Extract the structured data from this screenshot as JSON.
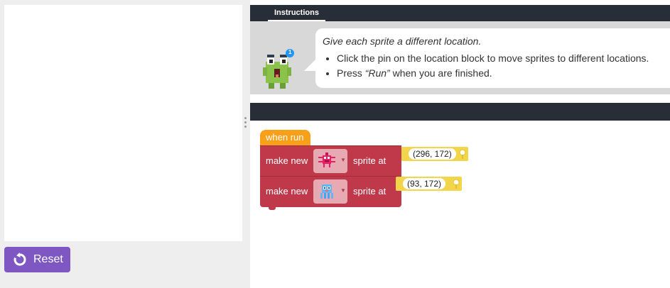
{
  "stage": {
    "reset_label": "Reset"
  },
  "instructions": {
    "tab_label": "Instructions",
    "title": "Give each sprite a different location.",
    "bullet1": "Click the pin on the location block to move sprites to different locations.",
    "bullet2_pre": "Press ",
    "bullet2_run": "“Run”",
    "bullet2_post": " when you are finished.",
    "badge_count": "1"
  },
  "workspace": {
    "hat_label": "when run",
    "blocks": [
      {
        "label": "make new",
        "label_after": "sprite at",
        "location": "(296, 172)",
        "sprite_icon": "pink-spider-sprite-icon"
      },
      {
        "label": "make new",
        "label_after": "sprite at",
        "location": "(93, 172)",
        "sprite_icon": "blue-octopus-sprite-icon"
      }
    ]
  },
  "colors": {
    "header_dark": "#282e38",
    "reset_purple": "#7e57c2",
    "hat_orange": "#f9a01b",
    "block_red": "#c0394a",
    "location_yellow": "#f2d54a"
  }
}
